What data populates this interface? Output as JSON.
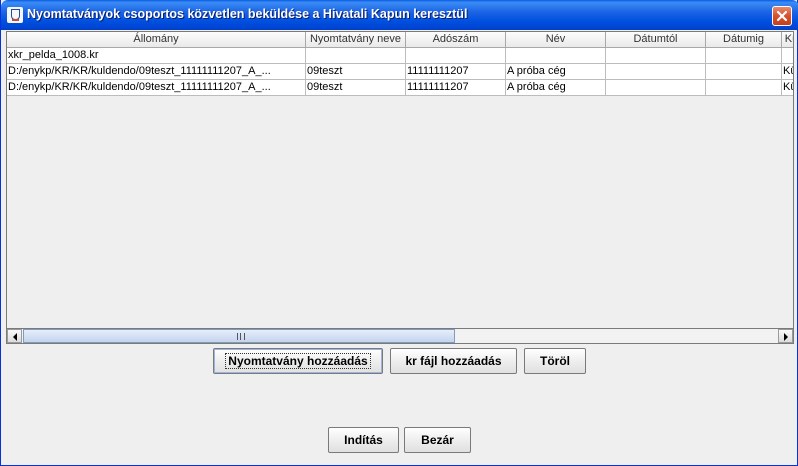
{
  "window": {
    "title": "Nyomtatványok csoportos közvetlen beküldése a Hivatali Kapun keresztül",
    "icon": "java-cup-icon",
    "close_icon": "close-icon"
  },
  "table": {
    "columns": [
      "Állomány",
      "Nyomtatvány neve",
      "Adószám",
      "Név",
      "Dátumtól",
      "Dátumig",
      "Kü"
    ],
    "rows": [
      [
        "xkr_pelda_1008.kr",
        "",
        "",
        "",
        "",
        "",
        ""
      ],
      [
        "D:/enykp/KR/KR/kuldendo/09teszt_11111111207_A_...",
        "09teszt",
        "11111111207",
        "A próba cég",
        "",
        "",
        "Kü"
      ],
      [
        "D:/enykp/KR/KR/kuldendo/09teszt_11111111207_A_...",
        "09teszt",
        "11111111207",
        "A próba cég",
        "",
        "",
        "Kü"
      ]
    ]
  },
  "buttons": {
    "add_form": "Nyomtatvány hozzáadás",
    "add_kr_file": "kr fájl hozzáadás",
    "delete": "Töröl",
    "start": "Indítás",
    "close": "Bezár"
  },
  "colors": {
    "titlebar": "#0054e3",
    "close_button": "#d8502c",
    "window_bg": "#efefef"
  }
}
